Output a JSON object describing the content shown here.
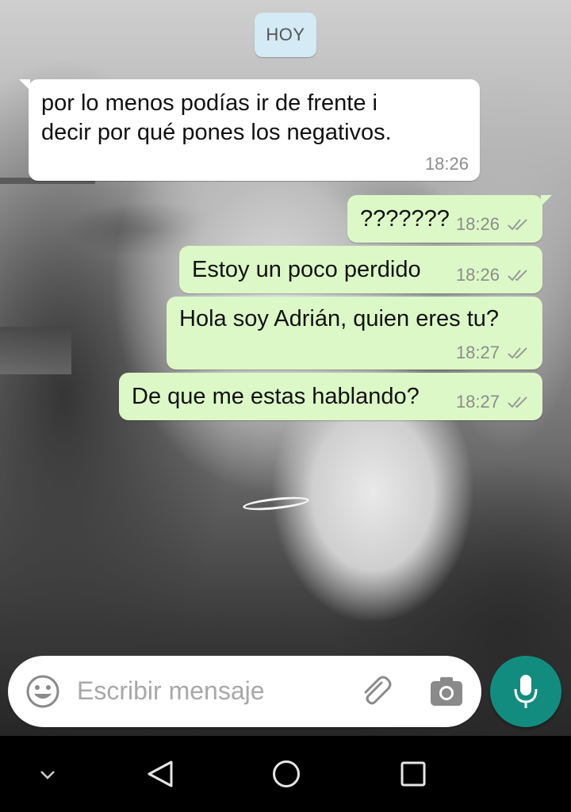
{
  "conversation": {
    "date_divider": "HOY",
    "messages": [
      {
        "direction": "incoming",
        "text": "por lo menos podías ir de frente i\ndecir por qué pones los negativos.",
        "time": "18:26"
      },
      {
        "direction": "outgoing",
        "text": "???????",
        "time": "18:26",
        "status": "read-double-check-icon"
      },
      {
        "direction": "outgoing",
        "text": "Estoy un poco perdido",
        "time": "18:26",
        "status": "read-double-check-icon"
      },
      {
        "direction": "outgoing",
        "text": "Hola soy Adrián, quien eres tu?",
        "time": "18:27",
        "status": "read-double-check-icon"
      },
      {
        "direction": "outgoing",
        "text": "De que me estas hablando?",
        "time": "18:27",
        "status": "read-double-check-icon"
      }
    ]
  },
  "composer": {
    "placeholder": "Escribir mensaje",
    "icons": [
      "emoji-icon",
      "attach-clip-icon",
      "camera-icon",
      "microphone-icon"
    ],
    "accent_color": "#128c7e"
  },
  "navbar": {
    "icons": [
      "chevron-down-icon",
      "back-triangle-icon",
      "home-circle-icon",
      "recents-square-icon"
    ]
  },
  "colors": {
    "incoming_bubble": "#ffffff",
    "outgoing_bubble": "#dcf8c6",
    "date_chip": "#d4eaf4"
  }
}
